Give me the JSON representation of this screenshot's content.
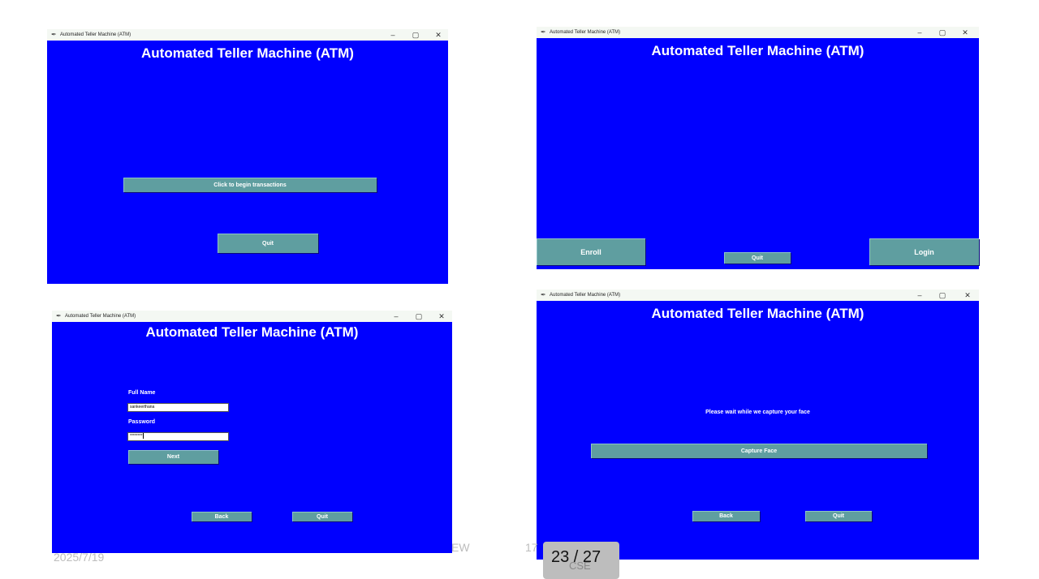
{
  "window_title": "Automated Teller Machine (ATM)",
  "window_controls": {
    "minimize": "–",
    "maximize": "▢",
    "close": "✕"
  },
  "app_icon": "feather-icon",
  "heading": "Automated Teller Machine (ATM)",
  "screen_welcome": {
    "begin_label": "Click to begin transactions",
    "quit_label": "Quit"
  },
  "screen_choice": {
    "enroll_label": "Enroll",
    "quit_label": "Quit",
    "login_label": "Login"
  },
  "screen_login": {
    "fullname_label": "Full Name",
    "fullname_value": "sankeerthana",
    "password_label": "Password",
    "password_value": "********",
    "next_label": "Next",
    "back_label": "Back",
    "quit_label": "Quit"
  },
  "screen_capture": {
    "message": "Please wait while we capture your face",
    "capture_label": "Capture Face",
    "back_label": "Back",
    "quit_label": "Quit"
  },
  "footer": {
    "date": "2025/7/19",
    "fragment_ew": "EW",
    "fragment_17": "17",
    "page_indicator": "23 / 27",
    "dept": "CSE"
  },
  "colors": {
    "window_bg": "#0000ff",
    "button_bg": "#5f9ea0",
    "titlebar_bg": "#f4f8f3"
  }
}
